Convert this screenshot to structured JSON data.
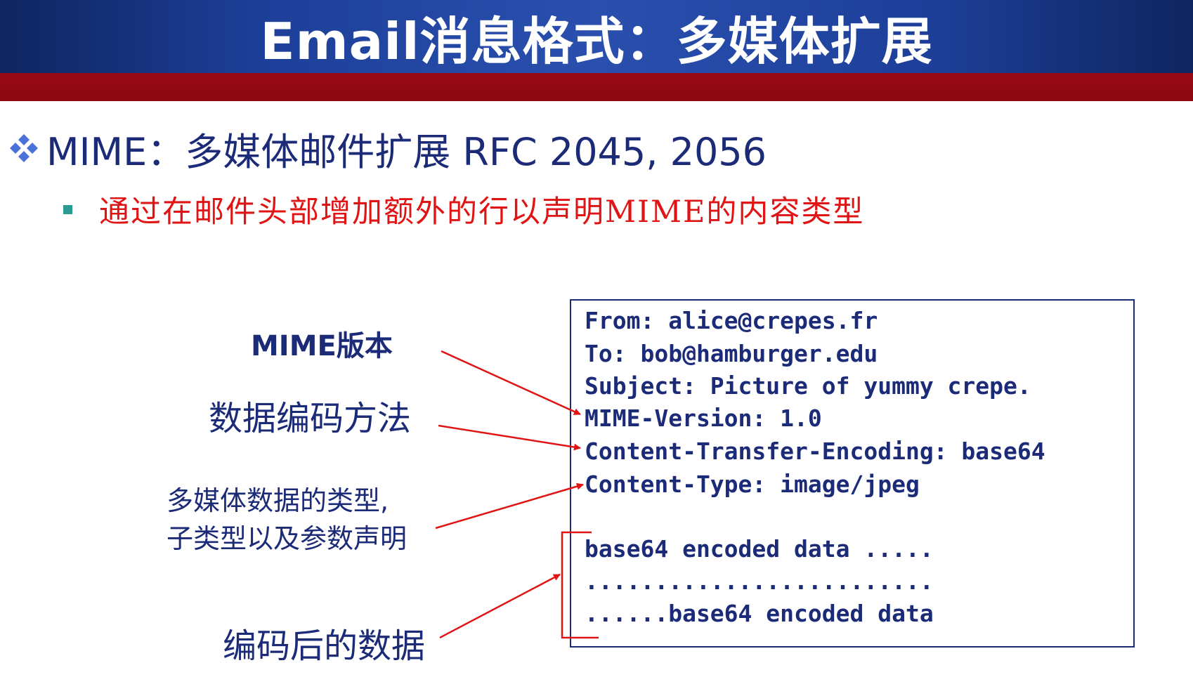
{
  "slide": {
    "title": "Email消息格式：多媒体扩展",
    "bullet_main": "MIME：多媒体邮件扩展 RFC 2045, 2056",
    "bullet_sub": "通过在邮件头部增加额外的行以声明MIME的内容类型"
  },
  "annotations": {
    "mime_version": "MIME版本",
    "encoding_method": "数据编码方法",
    "type_line1": "多媒体数据的类型,",
    "type_line2": "子类型以及参数声明",
    "encoded_data": "编码后的数据"
  },
  "message": {
    "from": "From: alice@crepes.fr",
    "to": "To: bob@hamburger.edu",
    "subject": "Subject: Picture of yummy crepe.",
    "mime_version": "MIME-Version: 1.0",
    "transfer_encoding": "Content-Transfer-Encoding: base64",
    "content_type": "Content-Type: image/jpeg",
    "body_line1": "base64 encoded data .....",
    "body_line2": ".........................",
    "body_line3": "......base64 encoded data"
  },
  "colors": {
    "title_bar": "#1d3f99",
    "red_band": "#8b0711",
    "text_navy": "#1c2b78",
    "sub_bullet_red": "#e01414",
    "sub_bullet_marker": "#2a9a93",
    "arrow_red": "#e01414"
  },
  "icons": {
    "main_bullet": "four-diamond-bullet-icon",
    "sub_bullet": "square-bullet-icon"
  }
}
